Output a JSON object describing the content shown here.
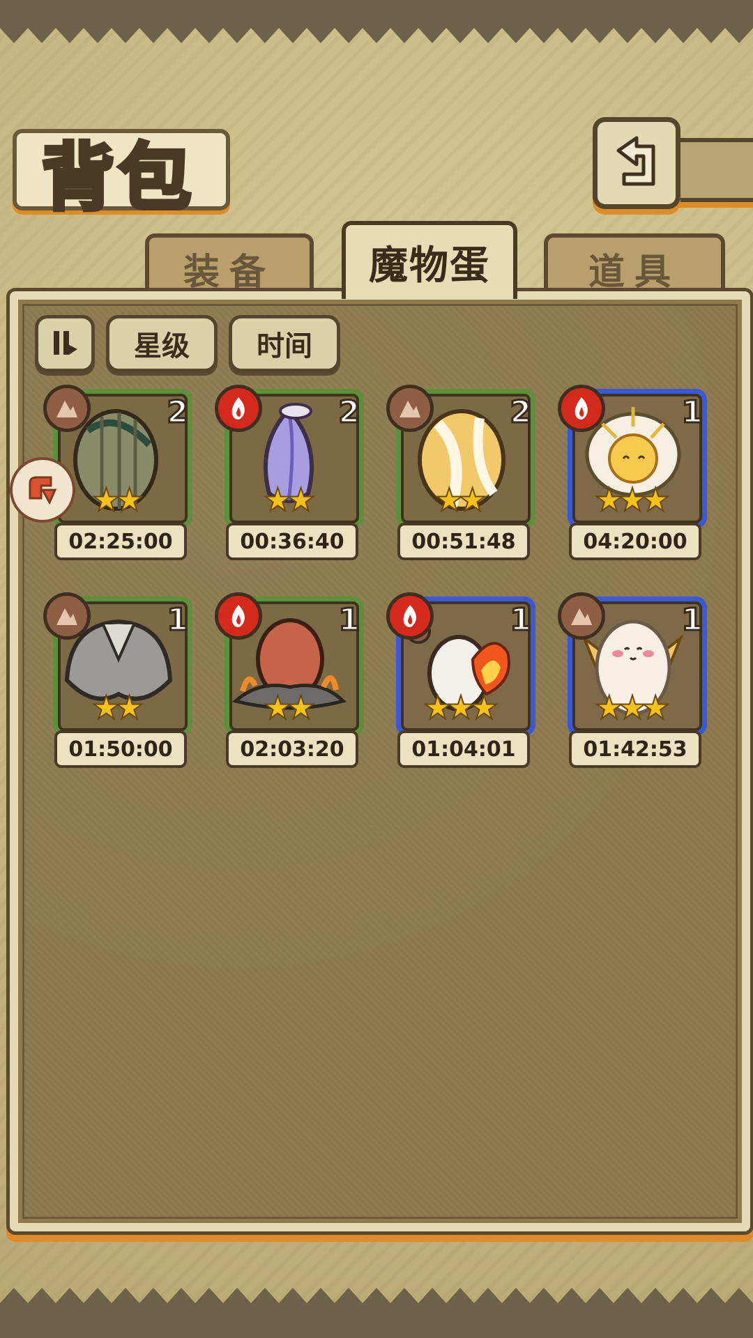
{
  "header": {
    "title": "背包"
  },
  "tabs": [
    {
      "label": "装备",
      "active": false
    },
    {
      "label": "魔物蛋",
      "active": true
    },
    {
      "label": "道具",
      "active": false
    }
  ],
  "sort": {
    "toggle_icon": "sort-toggle-icon",
    "star_label": "星级",
    "time_label": "时间"
  },
  "eggs": [
    {
      "element": "earth",
      "count": "2",
      "stars": "★★",
      "timer": "02:25:00",
      "frame": "green"
    },
    {
      "element": "fire",
      "count": "2",
      "stars": "★★",
      "timer": "00:36:40",
      "frame": "green"
    },
    {
      "element": "earth",
      "count": "2",
      "stars": "★★",
      "timer": "00:51:48",
      "frame": "green"
    },
    {
      "element": "fire",
      "count": "1",
      "stars": "★★★",
      "timer": "04:20:00",
      "frame": "blue"
    },
    {
      "element": "earth",
      "count": "1",
      "stars": "★★",
      "timer": "01:50:00",
      "frame": "green"
    },
    {
      "element": "fire",
      "count": "1",
      "stars": "★★",
      "timer": "02:03:20",
      "frame": "green"
    },
    {
      "element": "fire",
      "count": "1",
      "stars": "★★★",
      "timer": "01:04:01",
      "frame": "blue"
    },
    {
      "element": "earth",
      "count": "1",
      "stars": "★★★",
      "timer": "01:42:53",
      "frame": "blue"
    }
  ],
  "colors": {
    "green_frame": "#5e8f3a",
    "blue_frame": "#3b58d6",
    "fire": "#d42a1d",
    "earth": "#8e5f45",
    "accent": "#e08b2a"
  }
}
